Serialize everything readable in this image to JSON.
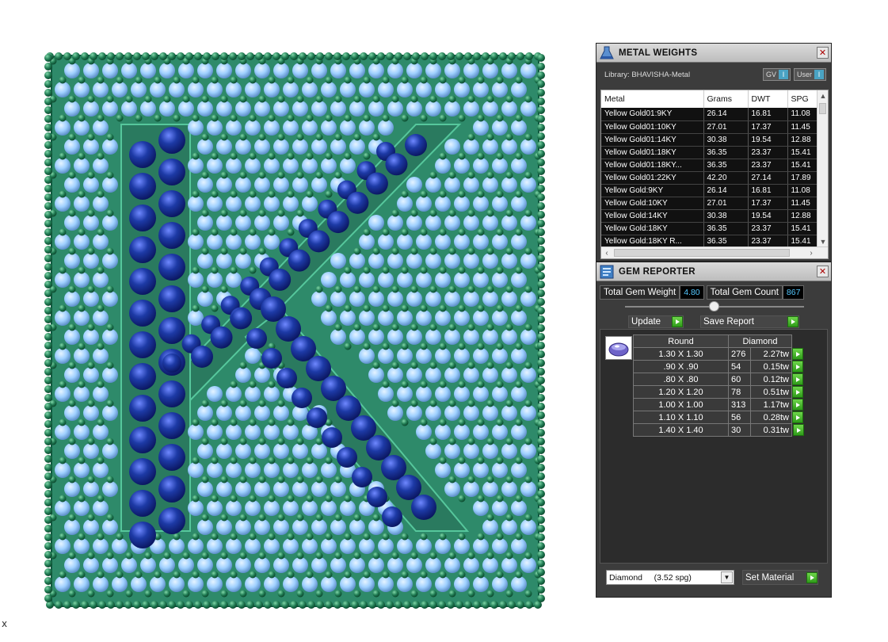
{
  "viewport": {
    "axis_marker": "x",
    "colors": {
      "frame": "#2e8a6a",
      "melee": "#1f7a52",
      "light_stone": "#9fd0ff",
      "dark_stone": "#1d3aa6"
    }
  },
  "metal_panel": {
    "title": "METAL WEIGHTS",
    "library_label": "Library: BHAVISHA-Metal",
    "toggle_gv": "GV",
    "toggle_user": "User",
    "toggle_button_glyph": "I",
    "columns": [
      "Metal",
      "Grams",
      "DWT",
      "SPG"
    ],
    "rows": [
      [
        "Yellow Gold01:9KY",
        "26.14",
        "16.81",
        "11.08"
      ],
      [
        "Yellow Gold01:10KY",
        "27.01",
        "17.37",
        "11.45"
      ],
      [
        "Yellow Gold01:14KY",
        "30.38",
        "19.54",
        "12.88"
      ],
      [
        "Yellow Gold01:18KY",
        "36.35",
        "23.37",
        "15.41"
      ],
      [
        "Yellow Gold01:18KY...",
        "36.35",
        "23.37",
        "15.41"
      ],
      [
        "Yellow Gold01:22KY",
        "42.20",
        "27.14",
        "17.89"
      ],
      [
        "Yellow Gold:9KY",
        "26.14",
        "16.81",
        "11.08"
      ],
      [
        "Yellow Gold:10KY",
        "27.01",
        "17.37",
        "11.45"
      ],
      [
        "Yellow Gold:14KY",
        "30.38",
        "19.54",
        "12.88"
      ],
      [
        "Yellow Gold:18KY",
        "36.35",
        "23.37",
        "15.41"
      ],
      [
        "Yellow Gold:18KY R...",
        "36.35",
        "23.37",
        "15.41"
      ]
    ]
  },
  "gem_panel": {
    "title": "GEM REPORTER",
    "total_weight_label": "Total Gem Weight",
    "total_weight_value": "4.80",
    "total_count_label": "Total Gem Count",
    "total_count_value": "867",
    "update_label": "Update",
    "save_label": "Save Report",
    "table_header_shape": "Round",
    "table_header_type": "Diamond",
    "rows": [
      {
        "size": "1.30 X 1.30",
        "count": "276",
        "weight": "2.27tw"
      },
      {
        "size": ".90 X .90",
        "count": "54",
        "weight": "0.15tw"
      },
      {
        "size": ".80 X .80",
        "count": "60",
        "weight": "0.12tw"
      },
      {
        "size": "1.20 X 1.20",
        "count": "78",
        "weight": "0.51tw"
      },
      {
        "size": "1.00 X 1.00",
        "count": "313",
        "weight": "1.17tw"
      },
      {
        "size": "1.10 X 1.10",
        "count": "56",
        "weight": "0.28tw"
      },
      {
        "size": "1.40 X 1.40",
        "count": "30",
        "weight": "0.31tw"
      }
    ],
    "material_select": "Diamond     (3.52 spg)",
    "set_material_label": "Set Material"
  }
}
